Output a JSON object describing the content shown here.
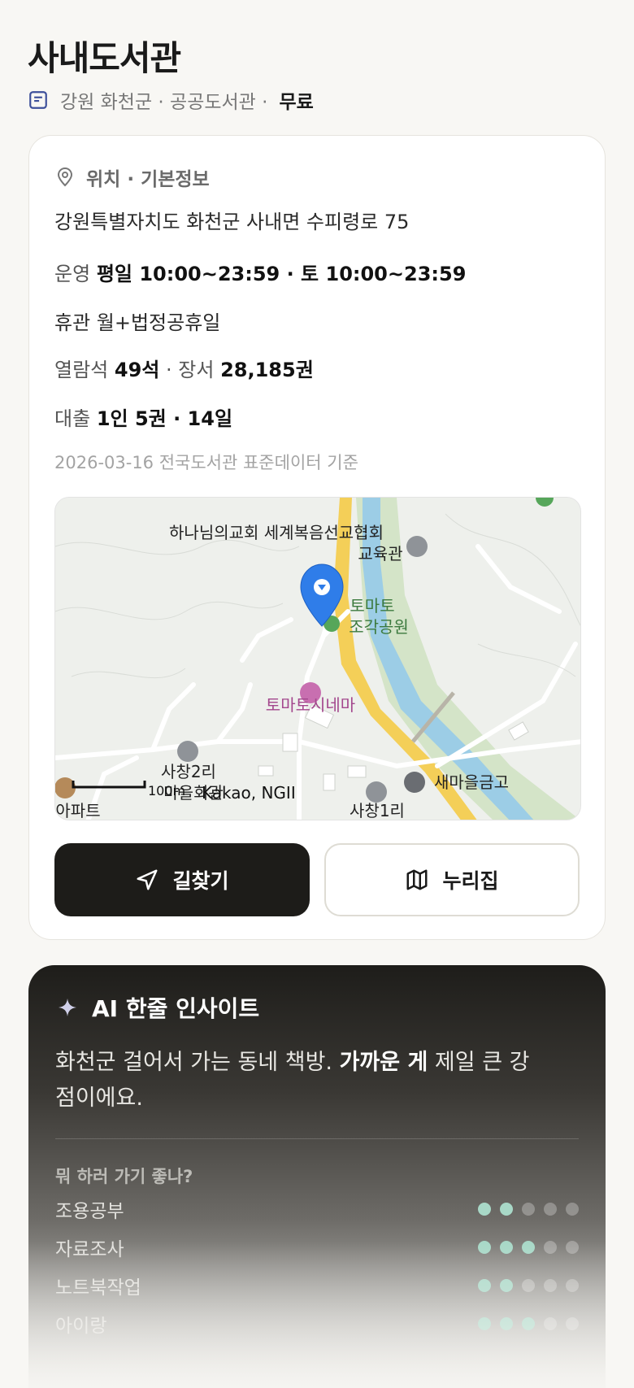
{
  "header": {
    "title": "사내도서관",
    "region": "강원 화천군 · 공공도서관 ·",
    "fee": "무료",
    "icon": "document-icon"
  },
  "info": {
    "section_title": "위치 · 기본정보",
    "address": "강원특별자치도 화천군 사내면 수피령로 75",
    "hours_label": "운영",
    "hours_value": "평일 10:00~23:59 · 토 10:00~23:59",
    "closed": "휴관 월+법정공휴일",
    "seats_label": "열람석",
    "seats_value": "49석",
    "books_label": "· 장서",
    "books_value": "28,185권",
    "loan_label": "대출",
    "loan_value": "1인 5권 · 14일",
    "data_date": "2026-03-16 전국도서관 표준데이터 기준"
  },
  "map": {
    "labels": {
      "church": "하나님의교회 세계복음선교협회",
      "church2": "교육관",
      "park1": "토마토",
      "park2": "조각공원",
      "cinema": "토마토시네마",
      "village1": "사창2리",
      "village1b": "마을회관",
      "apt": "아파트",
      "bank": "새마을금고",
      "village2": "사창1리",
      "scale": "100m",
      "credit": "Kakao, NGII"
    }
  },
  "buttons": {
    "directions": "길찾기",
    "nurijip": "누리집"
  },
  "ai": {
    "title": "AI 한줄 인사이트",
    "text_pre": "화천군 걸어서 가는 동네 책방. ",
    "text_bold": "가까운 게",
    "text_post": " 제일 큰 강점이에요.",
    "question": "뭐 하러 가기 좋나?",
    "ratings": [
      {
        "name": "조용공부",
        "score": 2,
        "max": 5
      },
      {
        "name": "자료조사",
        "score": 3,
        "max": 5
      },
      {
        "name": "노트북작업",
        "score": 2,
        "max": 5
      },
      {
        "name": "아이랑",
        "score": 3,
        "max": 5
      }
    ]
  },
  "colors": {
    "accent_dark": "#1d1c19",
    "dot_on": "#a8d8c7",
    "marker": "#2f7de9"
  }
}
